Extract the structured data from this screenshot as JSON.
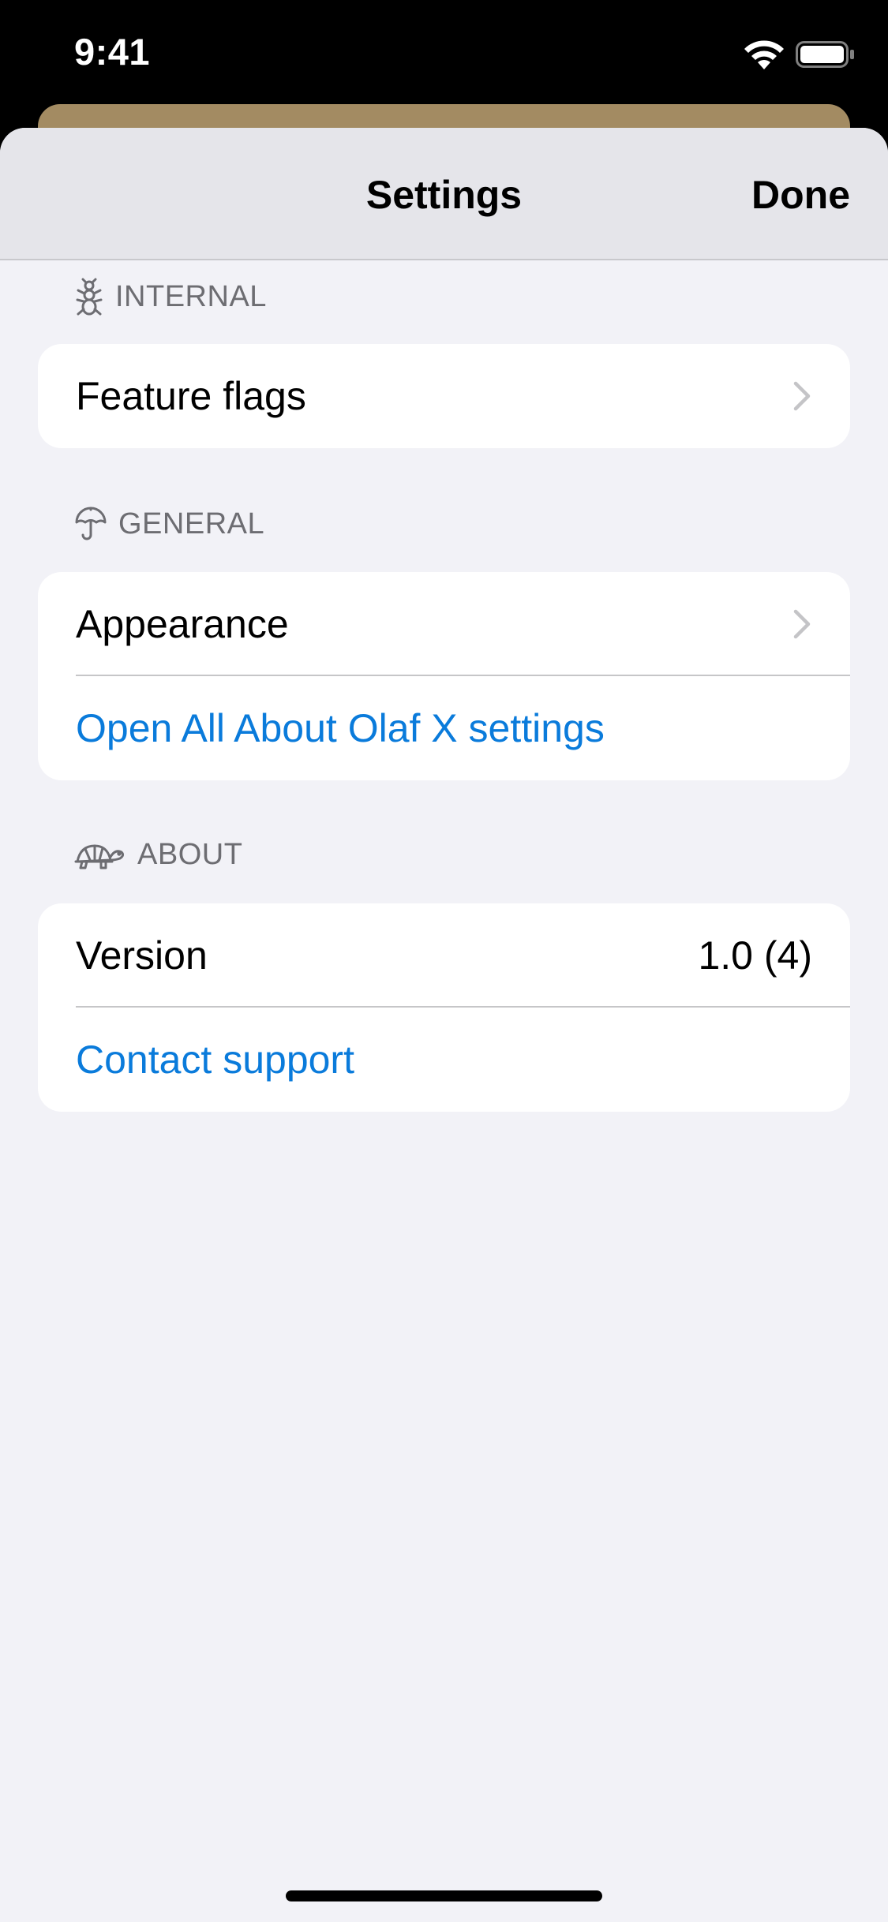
{
  "status_bar": {
    "time": "9:41",
    "icons": [
      "wifi-icon",
      "battery-icon"
    ]
  },
  "nav": {
    "title": "Settings",
    "done_label": "Done"
  },
  "sections": {
    "internal": {
      "header": "INTERNAL",
      "icon": "ant-icon",
      "rows": {
        "feature_flags": "Feature flags"
      }
    },
    "general": {
      "header": "GENERAL",
      "icon": "umbrella-icon",
      "rows": {
        "appearance": "Appearance",
        "open_settings": "Open All About Olaf X settings"
      }
    },
    "about": {
      "header": "ABOUT",
      "icon": "turtle-icon",
      "rows": {
        "version_label": "Version",
        "version_value": "1.0 (4)",
        "contact_support": "Contact support"
      }
    }
  },
  "colors": {
    "link": "#0a7bdb",
    "background": "#f2f2f7",
    "nav_background": "#e5e5ea",
    "behind_card": "#a38b62",
    "secondary_text": "#6d6d72"
  }
}
